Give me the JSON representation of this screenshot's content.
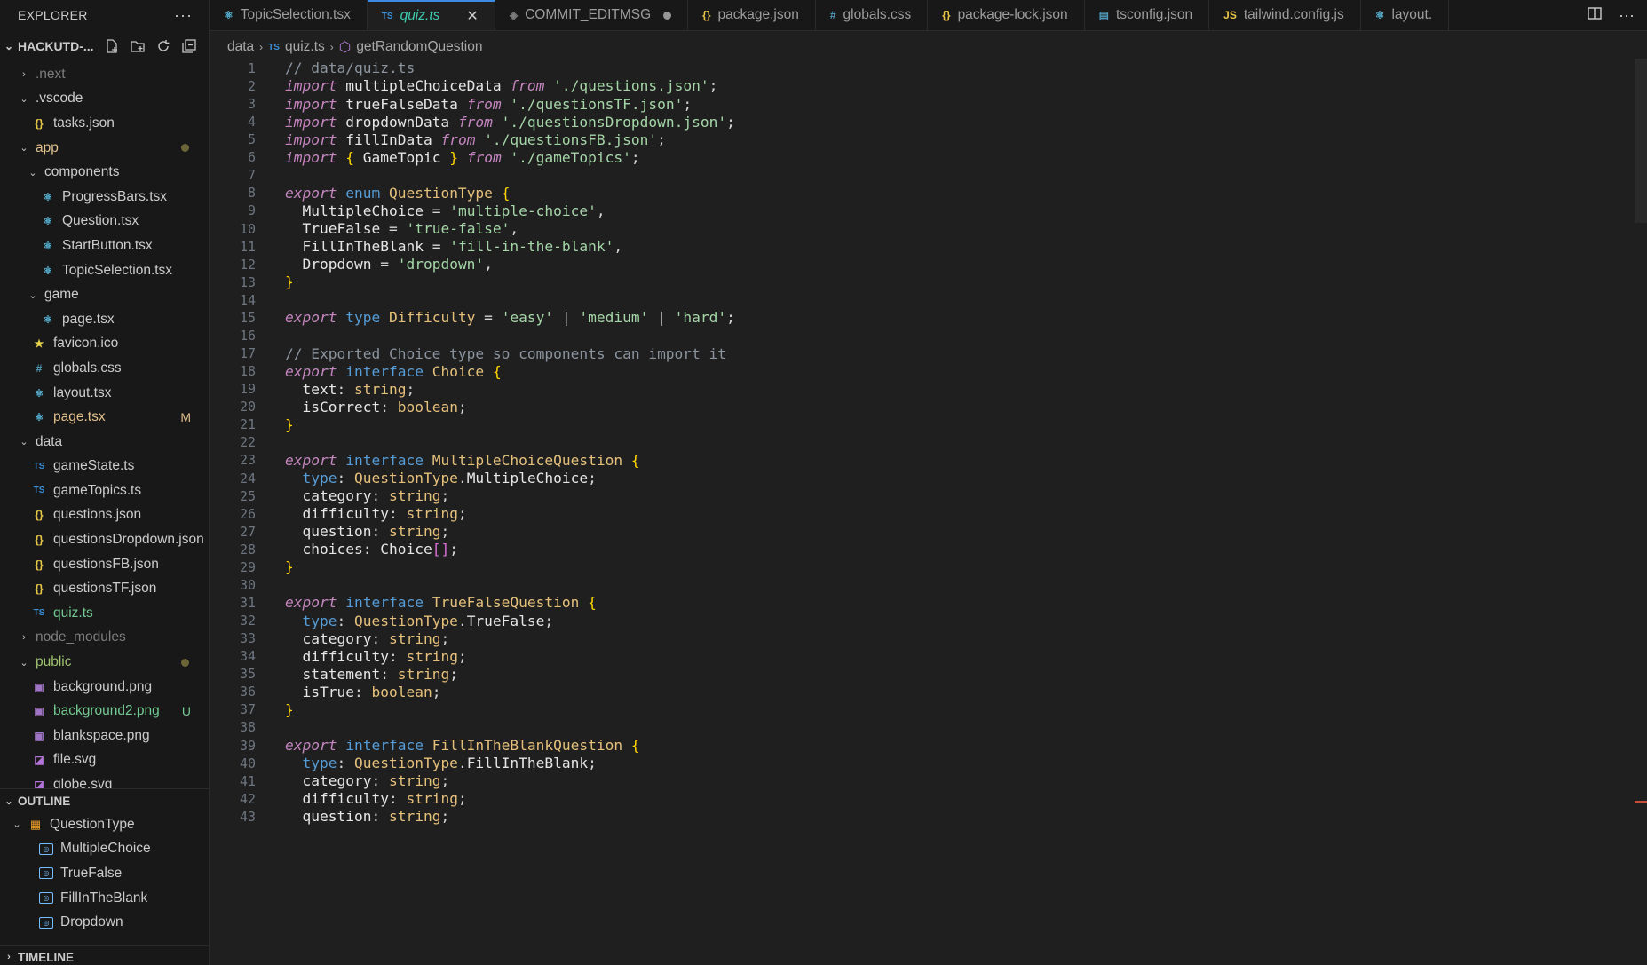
{
  "explorer": {
    "title": "EXPLORER",
    "project": "HACKUTD-...",
    "tree": [
      {
        "label": ".next",
        "indent": 0,
        "kind": "folder",
        "open": false,
        "icon": "",
        "style": "dim"
      },
      {
        "label": ".vscode",
        "indent": 0,
        "kind": "folder",
        "open": true,
        "icon": "",
        "style": ""
      },
      {
        "label": "tasks.json",
        "indent": 1,
        "kind": "file",
        "icon": "json",
        "style": ""
      },
      {
        "label": "app",
        "indent": 0,
        "kind": "folder",
        "open": true,
        "icon": "",
        "style": "mod",
        "dot": true
      },
      {
        "label": "components",
        "indent": 1,
        "kind": "folder",
        "open": true,
        "icon": "",
        "style": ""
      },
      {
        "label": "ProgressBars.tsx",
        "indent": 2,
        "kind": "file",
        "icon": "react",
        "style": ""
      },
      {
        "label": "Question.tsx",
        "indent": 2,
        "kind": "file",
        "icon": "react",
        "style": ""
      },
      {
        "label": "StartButton.tsx",
        "indent": 2,
        "kind": "file",
        "icon": "react",
        "style": ""
      },
      {
        "label": "TopicSelection.tsx",
        "indent": 2,
        "kind": "file",
        "icon": "react",
        "style": ""
      },
      {
        "label": "game",
        "indent": 1,
        "kind": "folder",
        "open": true,
        "icon": "",
        "style": ""
      },
      {
        "label": "page.tsx",
        "indent": 2,
        "kind": "file",
        "icon": "react",
        "style": ""
      },
      {
        "label": "favicon.ico",
        "indent": 1,
        "kind": "file",
        "icon": "star",
        "style": ""
      },
      {
        "label": "globals.css",
        "indent": 1,
        "kind": "file",
        "icon": "css",
        "style": ""
      },
      {
        "label": "layout.tsx",
        "indent": 1,
        "kind": "file",
        "icon": "react",
        "style": ""
      },
      {
        "label": "page.tsx",
        "indent": 1,
        "kind": "file",
        "icon": "react",
        "style": "mod",
        "badge": "M"
      },
      {
        "label": "data",
        "indent": 0,
        "kind": "folder",
        "open": true,
        "icon": "",
        "style": ""
      },
      {
        "label": "gameState.ts",
        "indent": 1,
        "kind": "file",
        "icon": "ts",
        "style": ""
      },
      {
        "label": "gameTopics.ts",
        "indent": 1,
        "kind": "file",
        "icon": "ts",
        "style": ""
      },
      {
        "label": "questions.json",
        "indent": 1,
        "kind": "file",
        "icon": "json",
        "style": ""
      },
      {
        "label": "questionsDropdown.json",
        "indent": 1,
        "kind": "file",
        "icon": "json",
        "style": ""
      },
      {
        "label": "questionsFB.json",
        "indent": 1,
        "kind": "file",
        "icon": "json",
        "style": ""
      },
      {
        "label": "questionsTF.json",
        "indent": 1,
        "kind": "file",
        "icon": "json",
        "style": ""
      },
      {
        "label": "quiz.ts",
        "indent": 1,
        "kind": "file",
        "icon": "ts",
        "style": "active"
      },
      {
        "label": "node_modules",
        "indent": 0,
        "kind": "folder",
        "open": false,
        "icon": "",
        "style": "dim"
      },
      {
        "label": "public",
        "indent": 0,
        "kind": "folder",
        "open": true,
        "icon": "",
        "style": "green",
        "dot": true
      },
      {
        "label": "background.png",
        "indent": 1,
        "kind": "file",
        "icon": "img",
        "style": ""
      },
      {
        "label": "background2.png",
        "indent": 1,
        "kind": "file",
        "icon": "img",
        "style": "untr",
        "badge": "U"
      },
      {
        "label": "blankspace.png",
        "indent": 1,
        "kind": "file",
        "icon": "img",
        "style": ""
      },
      {
        "label": "file.svg",
        "indent": 1,
        "kind": "file",
        "icon": "svg",
        "style": ""
      },
      {
        "label": "globe.svg",
        "indent": 1,
        "kind": "file",
        "icon": "svg",
        "style": ""
      }
    ]
  },
  "outline": {
    "title": "OUTLINE",
    "items": [
      {
        "label": "QuestionType",
        "kind": "enum",
        "indent": 1
      },
      {
        "label": "MultipleChoice",
        "kind": "member",
        "indent": 2
      },
      {
        "label": "TrueFalse",
        "kind": "member",
        "indent": 2
      },
      {
        "label": "FillInTheBlank",
        "kind": "member",
        "indent": 2
      },
      {
        "label": "Dropdown",
        "kind": "member",
        "indent": 2
      }
    ]
  },
  "timeline": {
    "title": "TIMELINE"
  },
  "tabs": [
    {
      "label": "TopicSelection.tsx",
      "icon": "react",
      "active": false
    },
    {
      "label": "quiz.ts",
      "icon": "ts",
      "active": true
    },
    {
      "label": "COMMIT_EDITMSG",
      "icon": "git",
      "active": false,
      "modified": true
    },
    {
      "label": "package.json",
      "icon": "json",
      "active": false
    },
    {
      "label": "globals.css",
      "icon": "css",
      "active": false
    },
    {
      "label": "package-lock.json",
      "icon": "json",
      "active": false
    },
    {
      "label": "tsconfig.json",
      "icon": "tsconfig",
      "active": false
    },
    {
      "label": "tailwind.config.js",
      "icon": "js",
      "active": false
    },
    {
      "label": "layout.",
      "icon": "react",
      "active": false
    }
  ],
  "breadcrumb": {
    "folder": "data",
    "file": "quiz.ts",
    "symbol": "getRandomQuestion"
  },
  "code_lines": [
    "// data/quiz.ts",
    "import multipleChoiceData from './questions.json';",
    "import trueFalseData from './questionsTF.json';",
    "import dropdownData from './questionsDropdown.json';",
    "import fillInData from './questionsFB.json';",
    "import { GameTopic } from './gameTopics';",
    "",
    "export enum QuestionType {",
    "  MultipleChoice = 'multiple-choice',",
    "  TrueFalse = 'true-false',",
    "  FillInTheBlank = 'fill-in-the-blank',",
    "  Dropdown = 'dropdown',",
    "}",
    "",
    "export type Difficulty = 'easy' | 'medium' | 'hard';",
    "",
    "// Exported Choice type so components can import it",
    "export interface Choice {",
    "  text: string;",
    "  isCorrect: boolean;",
    "}",
    "",
    "export interface MultipleChoiceQuestion {",
    "  type: QuestionType.MultipleChoice;",
    "  category: string;",
    "  difficulty: string;",
    "  question: string;",
    "  choices: Choice[];",
    "}",
    "",
    "export interface TrueFalseQuestion {",
    "  type: QuestionType.TrueFalse;",
    "  category: string;",
    "  difficulty: string;",
    "  statement: string;",
    "  isTrue: boolean;",
    "}",
    "",
    "export interface FillInTheBlankQuestion {",
    "  type: QuestionType.FillInTheBlank;",
    "  category: string;",
    "  difficulty: string;",
    "  question: string;"
  ]
}
